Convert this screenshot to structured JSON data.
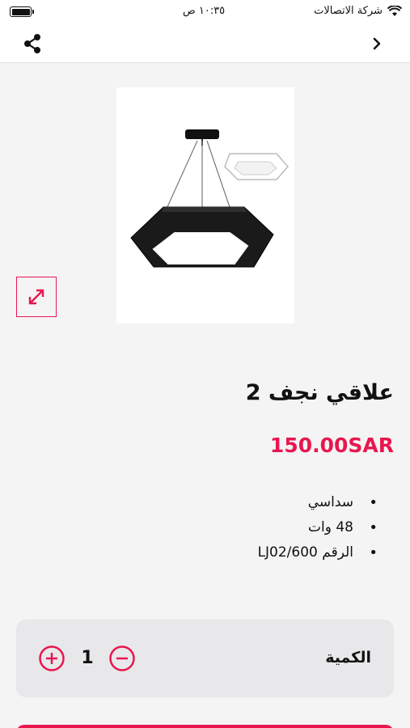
{
  "status_bar": {
    "carrier": "شركة الاتصالات",
    "time": "١٠:٣٥ ص",
    "wifi_icon": "wifi-icon",
    "battery_icon": "battery-icon"
  },
  "app_bar": {
    "back_icon": "chevron-right-icon",
    "share_icon": "share-icon"
  },
  "product": {
    "image_watermark": "",
    "title": "علاقي نجف 2",
    "price": "150.00SAR",
    "features": [
      "سداسي",
      "48 وات",
      "الرقم LJ02/600"
    ]
  },
  "quantity": {
    "label": "الكمية",
    "value": "1",
    "minus_icon": "minus-circle-icon",
    "plus_icon": "plus-circle-icon"
  },
  "colors": {
    "accent": "#e8174f",
    "background": "#f4f4f5",
    "card": "#e8e8ea"
  }
}
